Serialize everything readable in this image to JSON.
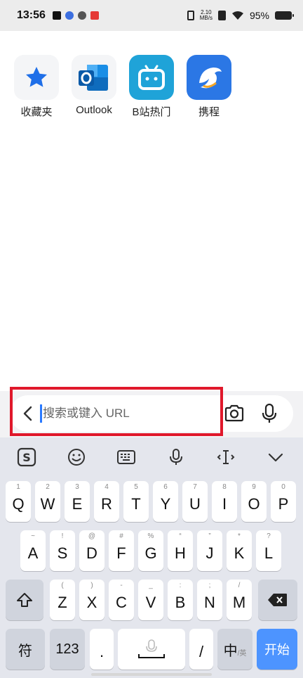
{
  "status_bar": {
    "time": "13:56",
    "net_speed_value": "2.10",
    "net_speed_unit": "MB/s",
    "battery": "95%"
  },
  "shortcuts": [
    {
      "label": "收藏夹",
      "icon": "star-icon",
      "color": "#1f6fe8"
    },
    {
      "label": "Outlook",
      "icon": "outlook-icon",
      "color": "#0f6cbd"
    },
    {
      "label": "B站热门",
      "icon": "bilibili-icon",
      "color": "#1fa3d8"
    },
    {
      "label": "携程",
      "icon": "ctrip-dolphin-icon",
      "color": "#2b77e5"
    }
  ],
  "address_bar": {
    "placeholder": "搜索或键入 URL",
    "back_icon": "chevron-left-icon",
    "camera_icon": "camera-icon",
    "mic_icon": "microphone-icon",
    "highlight_color": "#e0182b"
  },
  "keyboard": {
    "toolbar": [
      "sogou-logo-icon",
      "emoji-icon",
      "keyboard-icon",
      "voice-icon",
      "cursor-move-icon",
      "collapse-chevron-icon"
    ],
    "row1": [
      {
        "hint": "1",
        "key": "Q"
      },
      {
        "hint": "2",
        "key": "W"
      },
      {
        "hint": "3",
        "key": "E"
      },
      {
        "hint": "4",
        "key": "R"
      },
      {
        "hint": "5",
        "key": "T"
      },
      {
        "hint": "6",
        "key": "Y"
      },
      {
        "hint": "7",
        "key": "U"
      },
      {
        "hint": "8",
        "key": "I"
      },
      {
        "hint": "9",
        "key": "O"
      },
      {
        "hint": "0",
        "key": "P"
      }
    ],
    "row2": [
      {
        "hint": "~",
        "key": "A"
      },
      {
        "hint": "!",
        "key": "S"
      },
      {
        "hint": "@",
        "key": "D"
      },
      {
        "hint": "#",
        "key": "F"
      },
      {
        "hint": "%",
        "key": "G"
      },
      {
        "hint": "“",
        "key": "H"
      },
      {
        "hint": "”",
        "key": "J"
      },
      {
        "hint": "*",
        "key": "K"
      },
      {
        "hint": "?",
        "key": "L"
      }
    ],
    "row3": [
      {
        "hint": "(",
        "key": "Z"
      },
      {
        "hint": ")",
        "key": "X"
      },
      {
        "hint": "-",
        "key": "C"
      },
      {
        "hint": "_",
        "key": "V"
      },
      {
        "hint": ":",
        "key": "B"
      },
      {
        "hint": ";",
        "key": "N"
      },
      {
        "hint": "/",
        "key": "M"
      }
    ],
    "symbols_label": "符",
    "numbers_label": "123",
    "period_label": ".",
    "slash_label": "/",
    "lang_main": "中",
    "lang_alt": "/英",
    "go_label": "开始",
    "go_color": "#4d94ff"
  }
}
